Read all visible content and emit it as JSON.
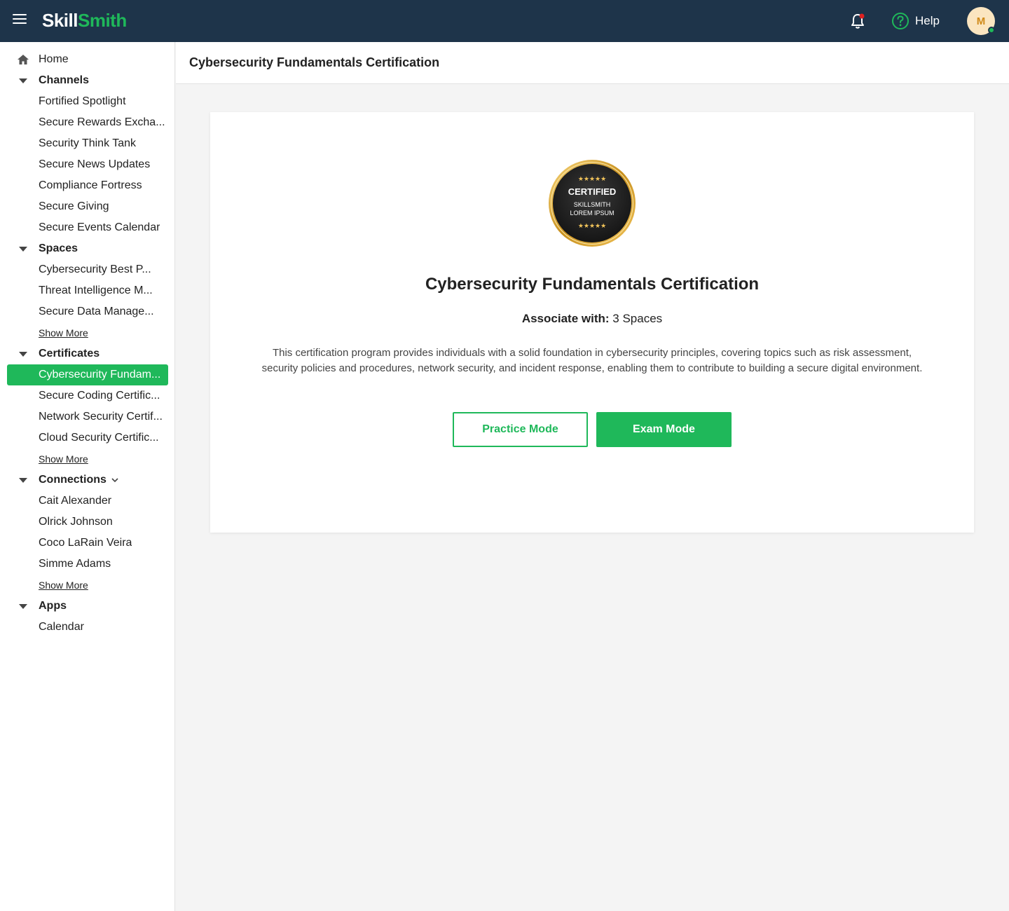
{
  "app": {
    "logo_part1": "Skill",
    "logo_part2": "Smith",
    "help_label": "Help",
    "avatar_initial": "M",
    "colors": {
      "topbar": "#1e344a",
      "accent": "#1fb85a",
      "notification_dot": "#e02020"
    }
  },
  "sidebar": {
    "home": "Home",
    "channels": {
      "label": "Channels",
      "items": [
        "Fortified Spotlight",
        "Secure Rewards Excha...",
        "Security Think Tank",
        "Secure News Updates",
        "Compliance Fortress",
        "Secure Giving",
        "Secure Events Calendar"
      ]
    },
    "spaces": {
      "label": "Spaces",
      "items": [
        "Cybersecurity Best P...",
        "Threat Intelligence M...",
        "Secure Data Manage..."
      ],
      "show_more": "Show More"
    },
    "certificates": {
      "label": "Certificates",
      "items": [
        "Cybersecurity Fundam...",
        "Secure Coding Certific...",
        "Network Security Certif...",
        "Cloud Security Certific..."
      ],
      "show_more": "Show More"
    },
    "connections": {
      "label": "Connections",
      "items": [
        "Cait Alexander",
        "Olrick Johnson",
        "Coco LaRain Veira",
        "Simme Adams"
      ],
      "show_more": "Show More"
    },
    "apps": {
      "label": "Apps",
      "items": [
        "Calendar"
      ]
    }
  },
  "page": {
    "header_title": "Cybersecurity Fundamentals Certification",
    "badge": {
      "line1": "CERTIFIED",
      "line2": "SKILLSMITH",
      "line3": "LOREM IPSUM",
      "stars": "★★★★★"
    },
    "title": "Cybersecurity Fundamentals Certification",
    "associate_label": "Associate with:",
    "associate_value": "3 Spaces",
    "description": "This certification program provides individuals with a solid foundation in cybersecurity principles, covering topics such as risk assessment, security policies and procedures, network security, and incident response, enabling them to contribute to building a secure digital environment.",
    "practice_button": "Practice Mode",
    "exam_button": "Exam Mode"
  }
}
